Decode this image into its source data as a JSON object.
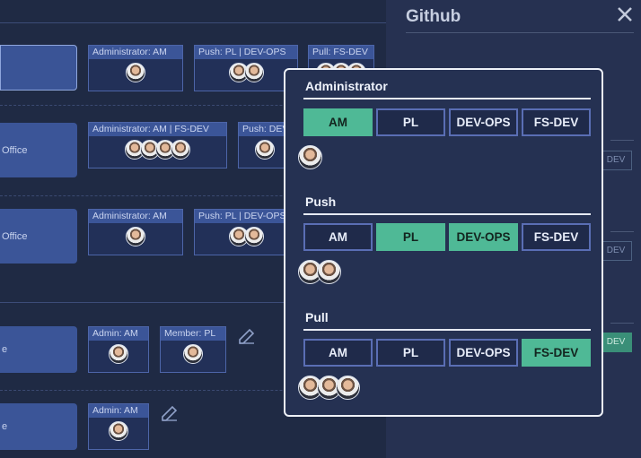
{
  "apps": [
    {
      "label": ""
    },
    {
      "label": "Office"
    },
    {
      "label": "Office"
    },
    {
      "label": "e"
    },
    {
      "label": "e"
    }
  ],
  "badges": [
    {
      "title": "Administrator:  AM"
    },
    {
      "title": "Push:  PL  | DEV-OPS"
    },
    {
      "title": "Pull:  FS-DEV"
    },
    {
      "title": "Administrator:  AM  | FS-DEV"
    },
    {
      "title": "Push:  DEV"
    },
    {
      "title": "Administrator:  AM"
    },
    {
      "title": "Push:  PL  | DEV-OPS"
    },
    {
      "title": "Admin:  AM"
    },
    {
      "title": "Member:  PL"
    },
    {
      "title": "Admin:  AM"
    }
  ],
  "side_panel": {
    "title": "Github",
    "ghost_labels": [
      "DEV",
      "DEV",
      "DEV"
    ]
  },
  "popup": {
    "sections": [
      {
        "title": "Administrator",
        "chips": [
          "AM",
          "PL",
          "DEV-OPS",
          "FS-DEV"
        ],
        "active": [
          "AM"
        ]
      },
      {
        "title": "Push",
        "chips": [
          "AM",
          "PL",
          "DEV-OPS",
          "FS-DEV"
        ],
        "active": [
          "PL",
          "DEV-OPS"
        ]
      },
      {
        "title": "Pull",
        "chips": [
          "AM",
          "PL",
          "DEV-OPS",
          "FS-DEV"
        ],
        "active": [
          "FS-DEV"
        ]
      }
    ]
  },
  "colors": {
    "accent": "#4fb996",
    "card": "#3b5598",
    "panel": "#253152"
  },
  "icons": [
    "close-icon",
    "edit-icon",
    "avatar"
  ]
}
